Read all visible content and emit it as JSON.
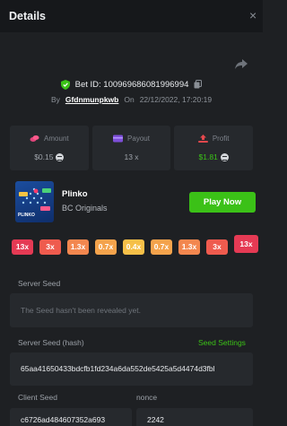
{
  "header": {
    "title": "Details"
  },
  "bet": {
    "id_label": "Bet ID: 100969686081996994",
    "by_prefix": "By",
    "username": "Gfdnmunpkwb",
    "on_label": "On",
    "datetime": "22/12/2022, 17:20:19"
  },
  "stats": {
    "amount": {
      "label": "Amount",
      "value": "$0.15"
    },
    "payout": {
      "label": "Payout",
      "value": "13 x"
    },
    "profit": {
      "label": "Profit",
      "value": "$1.81"
    }
  },
  "game": {
    "thumb_text": "PLINKO",
    "name": "Plinko",
    "provider": "BC Originals",
    "play_label": "Play Now"
  },
  "multipliers": [
    {
      "label": "13x",
      "color": "#e53a54"
    },
    {
      "label": "3x",
      "color": "#ef5b4e"
    },
    {
      "label": "1.3x",
      "color": "#f3874f"
    },
    {
      "label": "0.7x",
      "color": "#f4a34c"
    },
    {
      "label": "0.4x",
      "color": "#f6c048"
    },
    {
      "label": "0.7x",
      "color": "#f4a34c"
    },
    {
      "label": "1.3x",
      "color": "#f3874f"
    },
    {
      "label": "3x",
      "color": "#ef5b4e"
    },
    {
      "label": "13x",
      "color": "#e53a54"
    }
  ],
  "highlighted_multiplier_index": 8,
  "seeds": {
    "server_seed_label": "Server Seed",
    "server_seed_placeholder": "The Seed hasn't been revealed yet.",
    "server_seed_hash_label": "Server Seed (hash)",
    "seed_settings_label": "Seed Settings",
    "server_seed_hash": "65aa41650433bdcfb1fd234a6da552de5425a5d4474d3fbl",
    "client_seed_label": "Client Seed",
    "client_seed": "c6726ad484607352a693",
    "nonce_label": "nonce",
    "nonce": "2242"
  },
  "colors": {
    "accent_green": "#3bc117",
    "background": "#1e2023",
    "panel": "#26292d"
  }
}
